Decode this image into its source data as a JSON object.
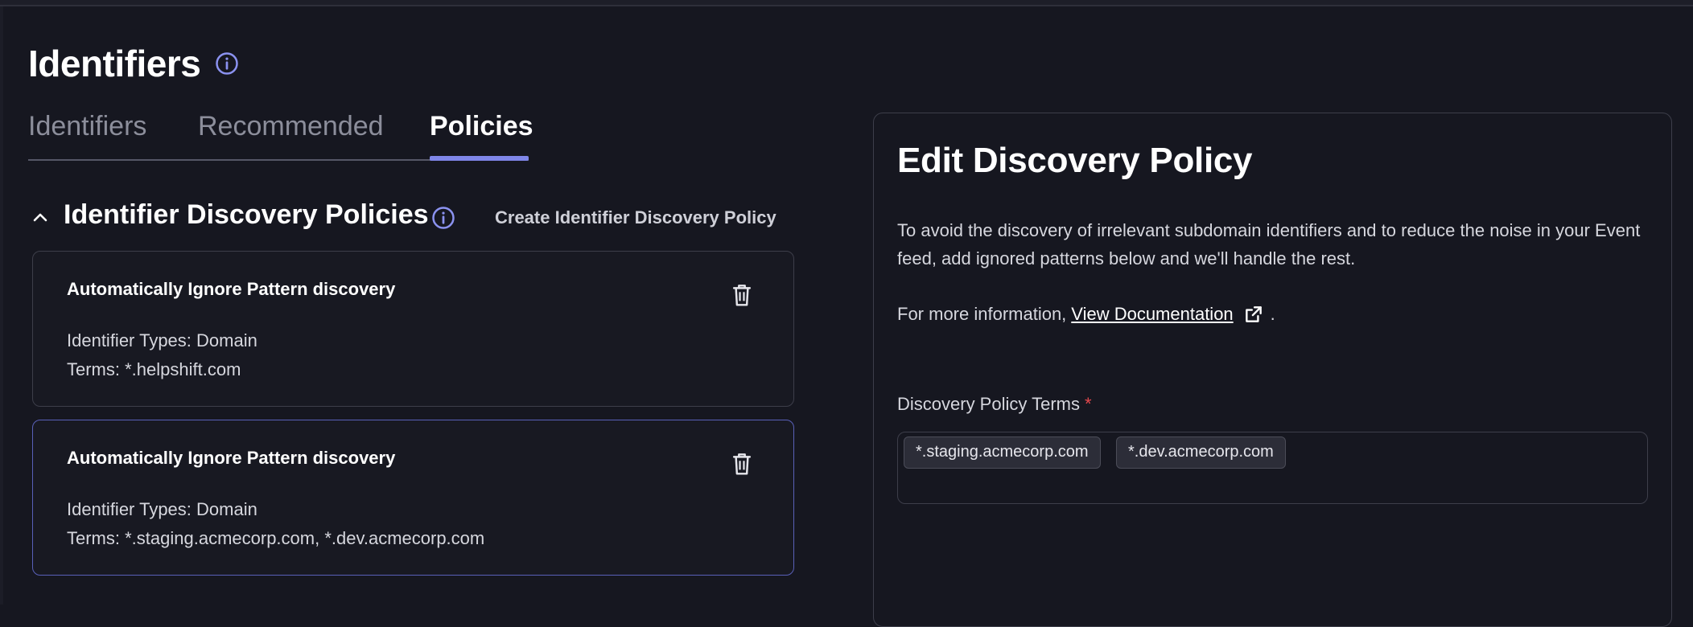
{
  "page": {
    "title": "Identifiers"
  },
  "tabs": [
    {
      "label": "Identifiers",
      "active": false
    },
    {
      "label": "Recommended",
      "active": false
    },
    {
      "label": "Policies",
      "active": true
    }
  ],
  "section": {
    "title": "Identifier Discovery Policies",
    "create_label": "Create Identifier Discovery Policy"
  },
  "policies": [
    {
      "title": "Automatically Ignore Pattern discovery",
      "types": "Identifier Types: Domain",
      "terms": "Terms: *.helpshift.com",
      "selected": false
    },
    {
      "title": "Automatically Ignore Pattern discovery",
      "types": "Identifier Types: Domain",
      "terms": "Terms: *.staging.acmecorp.com, *.dev.acmecorp.com",
      "selected": true
    }
  ],
  "edit_panel": {
    "title": "Edit Discovery Policy",
    "description": "To avoid the discovery of irrelevant subdomain identifiers and to reduce the noise in your Event feed, add ignored patterns below and we'll handle the rest.",
    "more_info_prefix": "For more information,",
    "doc_link": "View Documentation",
    "more_info_suffix": ".",
    "field_label": "Discovery Policy Terms",
    "required_mark": "*",
    "terms": [
      "*.staging.acmecorp.com",
      "*.dev.acmecorp.com"
    ]
  },
  "colors": {
    "background": "#161720",
    "accent": "#7f86e8",
    "selected_border": "#5960b8",
    "required": "#e5484d"
  },
  "icons": {
    "title_info": "info-circle-icon",
    "section_collapse": "chevron-up-icon",
    "delete": "trash-icon",
    "external_link": "external-link-icon"
  }
}
